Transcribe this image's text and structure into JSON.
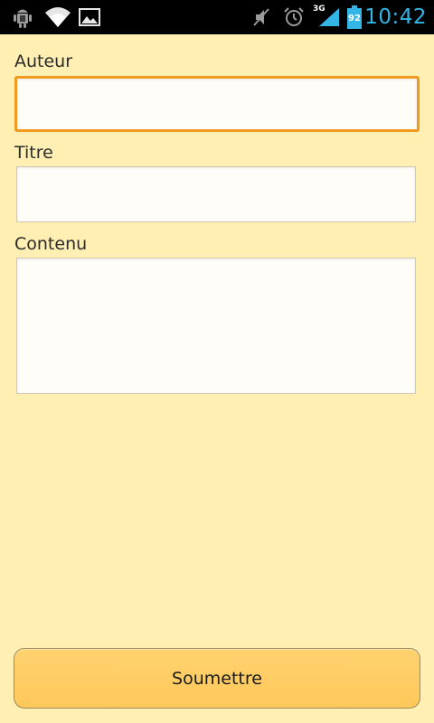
{
  "status_bar": {
    "time": "10:42",
    "network_type": "3G",
    "battery_level": "92",
    "icons": [
      "android-debug-icon",
      "wifi-icon",
      "image-icon",
      "mute-icon",
      "alarm-icon",
      "signal-icon",
      "battery-icon"
    ],
    "accent_color": "#33B5E5"
  },
  "form": {
    "author_label": "Auteur",
    "author_value": "",
    "title_label": "Titre",
    "title_value": "",
    "content_label": "Contenu",
    "content_value": "",
    "submit_label": "Soumettre"
  },
  "colors": {
    "background": "#FFEFB3",
    "focus_border": "#F29A1F",
    "button": "#FFCB63"
  }
}
